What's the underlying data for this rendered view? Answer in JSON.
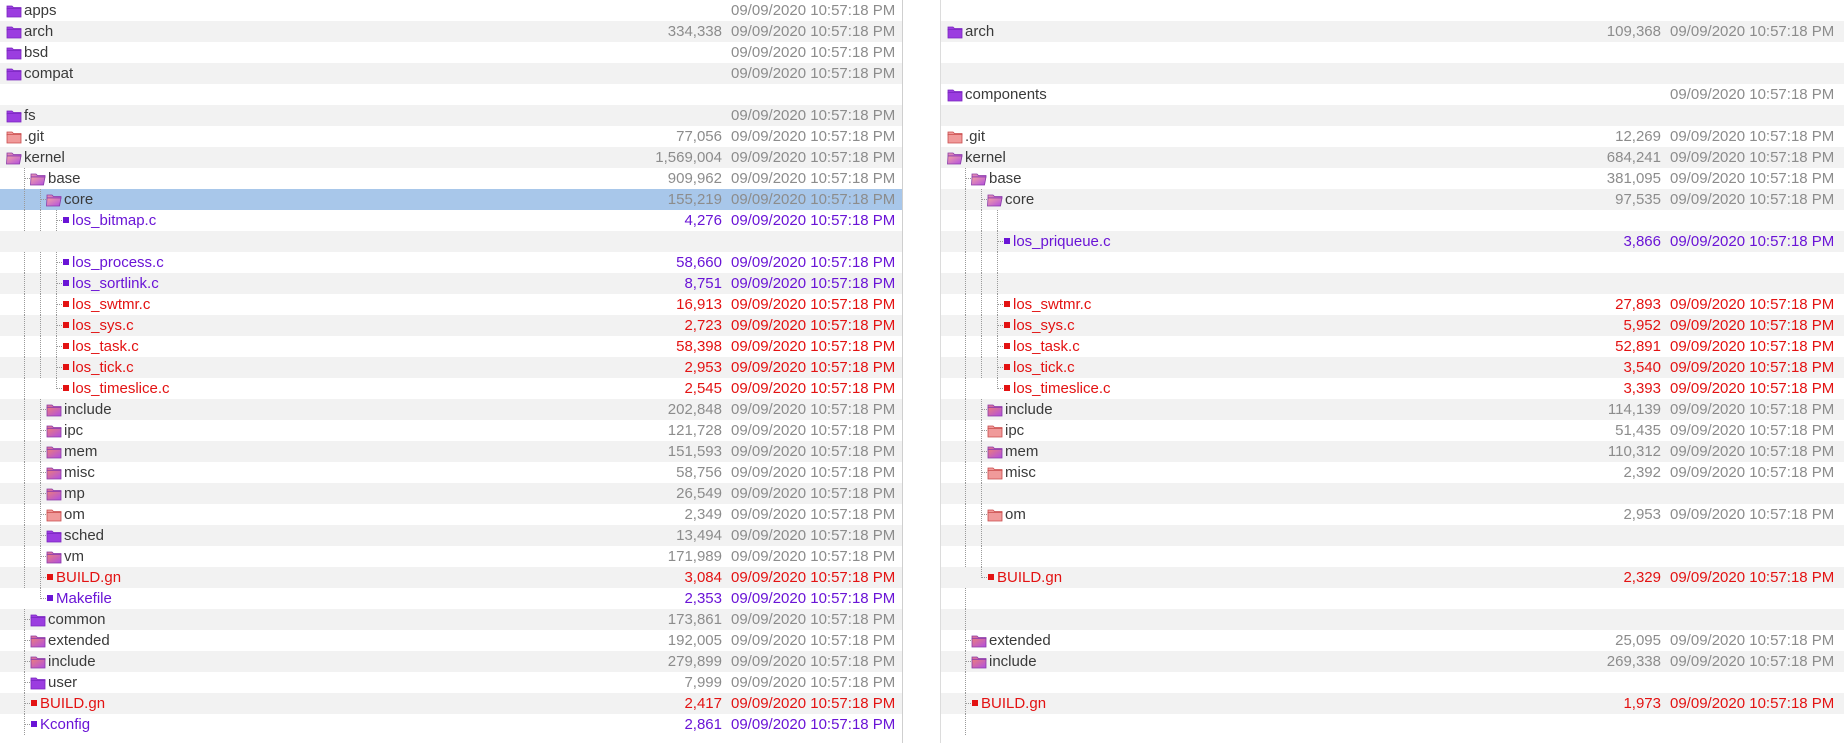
{
  "colors": {
    "dir_purple": "#9b3de0",
    "dir_red": "#e86a6a",
    "file_purple": "#6a14d6",
    "file_red": "#e31212",
    "selection": "#a8c7ea"
  },
  "left": {
    "rows": [
      {
        "kind": "dir",
        "name": "apps",
        "size": "",
        "date": "09/09/2020 10:57:18 PM",
        "depth": 0,
        "icon": "folder-purple-icon",
        "open": false
      },
      {
        "kind": "dir",
        "name": "arch",
        "size": "334,338",
        "date": "09/09/2020 10:57:18 PM",
        "depth": 0,
        "icon": "folder-purple-icon",
        "open": false
      },
      {
        "kind": "dir",
        "name": "bsd",
        "size": "",
        "date": "09/09/2020 10:57:18 PM",
        "depth": 0,
        "icon": "folder-purple-icon",
        "open": false
      },
      {
        "kind": "dir",
        "name": "compat",
        "size": "",
        "date": "09/09/2020 10:57:18 PM",
        "depth": 0,
        "icon": "folder-purple-icon",
        "open": false
      },
      {
        "kind": "blank"
      },
      {
        "kind": "dir",
        "name": "fs",
        "size": "",
        "date": "09/09/2020 10:57:18 PM",
        "depth": 0,
        "icon": "folder-purple-icon",
        "open": false
      },
      {
        "kind": "dir",
        "name": ".git",
        "size": "77,056",
        "date": "09/09/2020 10:57:18 PM",
        "depth": 0,
        "icon": "folder-red-icon",
        "open": false
      },
      {
        "kind": "dir",
        "name": "kernel",
        "size": "1,569,004",
        "date": "09/09/2020 10:57:18 PM",
        "depth": 0,
        "icon": "folder-open-mixed-icon",
        "open": true
      },
      {
        "kind": "dir",
        "name": "base",
        "size": "909,962",
        "date": "09/09/2020 10:57:18 PM",
        "depth": 1,
        "icon": "folder-open-mixed-icon",
        "open": true
      },
      {
        "kind": "dir",
        "name": "core",
        "size": "155,219",
        "date": "09/09/2020 10:57:18 PM",
        "depth": 2,
        "icon": "folder-open-mixed-icon",
        "open": true,
        "selected": true
      },
      {
        "kind": "file",
        "name": "los_bitmap.c",
        "size": "4,276",
        "date": "09/09/2020 10:57:18 PM",
        "depth": 3,
        "color": "purple"
      },
      {
        "kind": "blank"
      },
      {
        "kind": "file",
        "name": "los_process.c",
        "size": "58,660",
        "date": "09/09/2020 10:57:18 PM",
        "depth": 3,
        "color": "purple"
      },
      {
        "kind": "file",
        "name": "los_sortlink.c",
        "size": "8,751",
        "date": "09/09/2020 10:57:18 PM",
        "depth": 3,
        "color": "purple"
      },
      {
        "kind": "file",
        "name": "los_swtmr.c",
        "size": "16,913",
        "date": "09/09/2020 10:57:18 PM",
        "depth": 3,
        "color": "red"
      },
      {
        "kind": "file",
        "name": "los_sys.c",
        "size": "2,723",
        "date": "09/09/2020 10:57:18 PM",
        "depth": 3,
        "color": "red"
      },
      {
        "kind": "file",
        "name": "los_task.c",
        "size": "58,398",
        "date": "09/09/2020 10:57:18 PM",
        "depth": 3,
        "color": "red"
      },
      {
        "kind": "file",
        "name": "los_tick.c",
        "size": "2,953",
        "date": "09/09/2020 10:57:18 PM",
        "depth": 3,
        "color": "red"
      },
      {
        "kind": "file",
        "name": "los_timeslice.c",
        "size": "2,545",
        "date": "09/09/2020 10:57:18 PM",
        "depth": 3,
        "color": "red",
        "last": true
      },
      {
        "kind": "dir",
        "name": "include",
        "size": "202,848",
        "date": "09/09/2020 10:57:18 PM",
        "depth": 2,
        "icon": "folder-mixed-icon",
        "open": false
      },
      {
        "kind": "dir",
        "name": "ipc",
        "size": "121,728",
        "date": "09/09/2020 10:57:18 PM",
        "depth": 2,
        "icon": "folder-mixed-icon",
        "open": false
      },
      {
        "kind": "dir",
        "name": "mem",
        "size": "151,593",
        "date": "09/09/2020 10:57:18 PM",
        "depth": 2,
        "icon": "folder-mixed-icon",
        "open": false
      },
      {
        "kind": "dir",
        "name": "misc",
        "size": "58,756",
        "date": "09/09/2020 10:57:18 PM",
        "depth": 2,
        "icon": "folder-mixed-icon",
        "open": false
      },
      {
        "kind": "dir",
        "name": "mp",
        "size": "26,549",
        "date": "09/09/2020 10:57:18 PM",
        "depth": 2,
        "icon": "folder-mixed-icon",
        "open": false
      },
      {
        "kind": "dir",
        "name": "om",
        "size": "2,349",
        "date": "09/09/2020 10:57:18 PM",
        "depth": 2,
        "icon": "folder-red-icon",
        "open": false
      },
      {
        "kind": "dir",
        "name": "sched",
        "size": "13,494",
        "date": "09/09/2020 10:57:18 PM",
        "depth": 2,
        "icon": "folder-purple-icon",
        "open": false
      },
      {
        "kind": "dir",
        "name": "vm",
        "size": "171,989",
        "date": "09/09/2020 10:57:18 PM",
        "depth": 2,
        "icon": "folder-mixed-icon",
        "open": false
      },
      {
        "kind": "file",
        "name": "BUILD.gn",
        "size": "3,084",
        "date": "09/09/2020 10:57:18 PM",
        "depth": 2,
        "color": "red"
      },
      {
        "kind": "file",
        "name": "Makefile",
        "size": "2,353",
        "date": "09/09/2020 10:57:18 PM",
        "depth": 2,
        "color": "purple",
        "last": true
      },
      {
        "kind": "dir",
        "name": "common",
        "size": "173,861",
        "date": "09/09/2020 10:57:18 PM",
        "depth": 1,
        "icon": "folder-purple-icon",
        "open": false
      },
      {
        "kind": "dir",
        "name": "extended",
        "size": "192,005",
        "date": "09/09/2020 10:57:18 PM",
        "depth": 1,
        "icon": "folder-mixed-icon",
        "open": false
      },
      {
        "kind": "dir",
        "name": "include",
        "size": "279,899",
        "date": "09/09/2020 10:57:18 PM",
        "depth": 1,
        "icon": "folder-mixed-icon",
        "open": false
      },
      {
        "kind": "dir",
        "name": "user",
        "size": "7,999",
        "date": "09/09/2020 10:57:18 PM",
        "depth": 1,
        "icon": "folder-purple-icon",
        "open": false
      },
      {
        "kind": "file",
        "name": "BUILD.gn",
        "size": "2,417",
        "date": "09/09/2020 10:57:18 PM",
        "depth": 1,
        "color": "red"
      },
      {
        "kind": "file",
        "name": "Kconfig",
        "size": "2,861",
        "date": "09/09/2020 10:57:18 PM",
        "depth": 1,
        "color": "purple"
      }
    ]
  },
  "right": {
    "rows": [
      {
        "kind": "blank"
      },
      {
        "kind": "dir",
        "name": "arch",
        "size": "109,368",
        "date": "09/09/2020 10:57:18 PM",
        "depth": 0,
        "icon": "folder-purple-icon",
        "open": false
      },
      {
        "kind": "blank"
      },
      {
        "kind": "blank"
      },
      {
        "kind": "dir",
        "name": "components",
        "size": "",
        "date": "09/09/2020 10:57:18 PM",
        "depth": 0,
        "icon": "folder-purple-icon",
        "open": false
      },
      {
        "kind": "blank"
      },
      {
        "kind": "dir",
        "name": ".git",
        "size": "12,269",
        "date": "09/09/2020 10:57:18 PM",
        "depth": 0,
        "icon": "folder-red-icon",
        "open": false
      },
      {
        "kind": "dir",
        "name": "kernel",
        "size": "684,241",
        "date": "09/09/2020 10:57:18 PM",
        "depth": 0,
        "icon": "folder-open-mixed-icon",
        "open": true
      },
      {
        "kind": "dir",
        "name": "base",
        "size": "381,095",
        "date": "09/09/2020 10:57:18 PM",
        "depth": 1,
        "icon": "folder-open-mixed-icon",
        "open": true
      },
      {
        "kind": "dir",
        "name": "core",
        "size": "97,535",
        "date": "09/09/2020 10:57:18 PM",
        "depth": 2,
        "icon": "folder-open-mixed-icon",
        "open": true
      },
      {
        "kind": "blank",
        "guides": 3
      },
      {
        "kind": "file",
        "name": "los_priqueue.c",
        "size": "3,866",
        "date": "09/09/2020 10:57:18 PM",
        "depth": 3,
        "color": "purple"
      },
      {
        "kind": "blank",
        "guides": 3
      },
      {
        "kind": "blank",
        "guides": 3
      },
      {
        "kind": "file",
        "name": "los_swtmr.c",
        "size": "27,893",
        "date": "09/09/2020 10:57:18 PM",
        "depth": 3,
        "color": "red"
      },
      {
        "kind": "file",
        "name": "los_sys.c",
        "size": "5,952",
        "date": "09/09/2020 10:57:18 PM",
        "depth": 3,
        "color": "red"
      },
      {
        "kind": "file",
        "name": "los_task.c",
        "size": "52,891",
        "date": "09/09/2020 10:57:18 PM",
        "depth": 3,
        "color": "red"
      },
      {
        "kind": "file",
        "name": "los_tick.c",
        "size": "3,540",
        "date": "09/09/2020 10:57:18 PM",
        "depth": 3,
        "color": "red"
      },
      {
        "kind": "file",
        "name": "los_timeslice.c",
        "size": "3,393",
        "date": "09/09/2020 10:57:18 PM",
        "depth": 3,
        "color": "red",
        "last": true
      },
      {
        "kind": "dir",
        "name": "include",
        "size": "114,139",
        "date": "09/09/2020 10:57:18 PM",
        "depth": 2,
        "icon": "folder-mixed-icon",
        "open": false
      },
      {
        "kind": "dir",
        "name": "ipc",
        "size": "51,435",
        "date": "09/09/2020 10:57:18 PM",
        "depth": 2,
        "icon": "folder-red-icon",
        "open": false
      },
      {
        "kind": "dir",
        "name": "mem",
        "size": "110,312",
        "date": "09/09/2020 10:57:18 PM",
        "depth": 2,
        "icon": "folder-mixed-icon",
        "open": false
      },
      {
        "kind": "dir",
        "name": "misc",
        "size": "2,392",
        "date": "09/09/2020 10:57:18 PM",
        "depth": 2,
        "icon": "folder-red-icon",
        "open": false
      },
      {
        "kind": "blank",
        "guides": 2
      },
      {
        "kind": "dir",
        "name": "om",
        "size": "2,953",
        "date": "09/09/2020 10:57:18 PM",
        "depth": 2,
        "icon": "folder-red-icon",
        "open": false
      },
      {
        "kind": "blank",
        "guides": 2
      },
      {
        "kind": "blank",
        "guides": 2
      },
      {
        "kind": "file",
        "name": "BUILD.gn",
        "size": "2,329",
        "date": "09/09/2020 10:57:18 PM",
        "depth": 2,
        "color": "red",
        "last": true
      },
      {
        "kind": "blank",
        "guides": 1
      },
      {
        "kind": "blank",
        "guides": 1
      },
      {
        "kind": "dir",
        "name": "extended",
        "size": "25,095",
        "date": "09/09/2020 10:57:18 PM",
        "depth": 1,
        "icon": "folder-mixed-icon",
        "open": false
      },
      {
        "kind": "dir",
        "name": "include",
        "size": "269,338",
        "date": "09/09/2020 10:57:18 PM",
        "depth": 1,
        "icon": "folder-mixed-icon",
        "open": false
      },
      {
        "kind": "blank",
        "guides": 1
      },
      {
        "kind": "file",
        "name": "BUILD.gn",
        "size": "1,973",
        "date": "09/09/2020 10:57:18 PM",
        "depth": 1,
        "color": "red"
      },
      {
        "kind": "blank",
        "guides": 1
      }
    ]
  }
}
